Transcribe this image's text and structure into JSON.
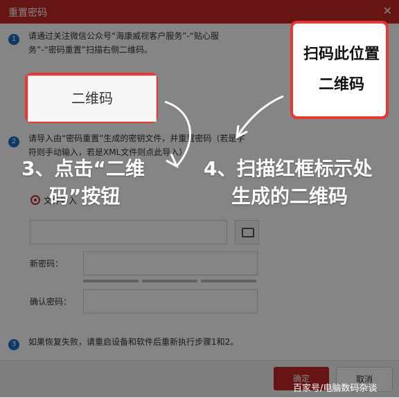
{
  "dialog": {
    "title": "重置密码",
    "close_icon": "close-icon"
  },
  "steps": [
    {
      "num": "1",
      "text_lines": [
        "请通过关注微信公众号“海康威视客户服务”-“贴心服",
        "务”-“密码重置”扫描右侧二维码。"
      ]
    },
    {
      "num": "2",
      "text_lines": [
        "请导入由“密码重置”生成的密钥文件，并重置密码（若是字",
        "符则手动输入，若是XML文件则点此导入）。"
      ]
    },
    {
      "num": "3",
      "text": "如果恢复失败，请重启设备和软件后重新执行步骤1和2。"
    }
  ],
  "buttons": {
    "generate_label": "二维码",
    "ok_label": "确定",
    "cancel_label": "取消"
  },
  "radio": {
    "label": "文件导入"
  },
  "fields": {
    "new_password_label": "新密码：",
    "confirm_password_label": "确认密码：",
    "file_path_value": ""
  },
  "qr_panel": {
    "line1": "扫码此位置",
    "line2": "二维码"
  },
  "annotations": {
    "note3_line1": "3、点击“二维",
    "note3_line2": "码”按钮",
    "note4_line1": "4、扫描红框标示处",
    "note4_line2": "生成的二维码"
  },
  "watermark": "百家号/电脑数码杂谈",
  "colors": {
    "dialog_title_bg": "#c62828",
    "highlight_red": "#e53935",
    "step_blue": "#1e6fc1"
  }
}
